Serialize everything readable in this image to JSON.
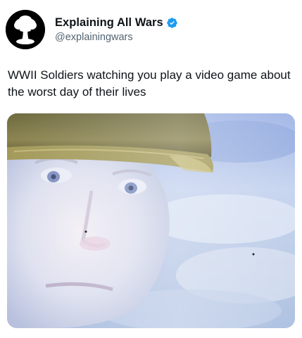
{
  "author": {
    "display_name": "Explaining All Wars",
    "handle": "@explainingwars",
    "verified": true,
    "verified_color": "#1d9bf0",
    "avatar_icon": "mushroom-cloud-icon"
  },
  "tweet": {
    "text": "WWII Soldiers watching you play a video game about the worst day of their lives"
  },
  "media": {
    "kind": "meme-image",
    "subject": "soldier-face-in-helmet"
  }
}
